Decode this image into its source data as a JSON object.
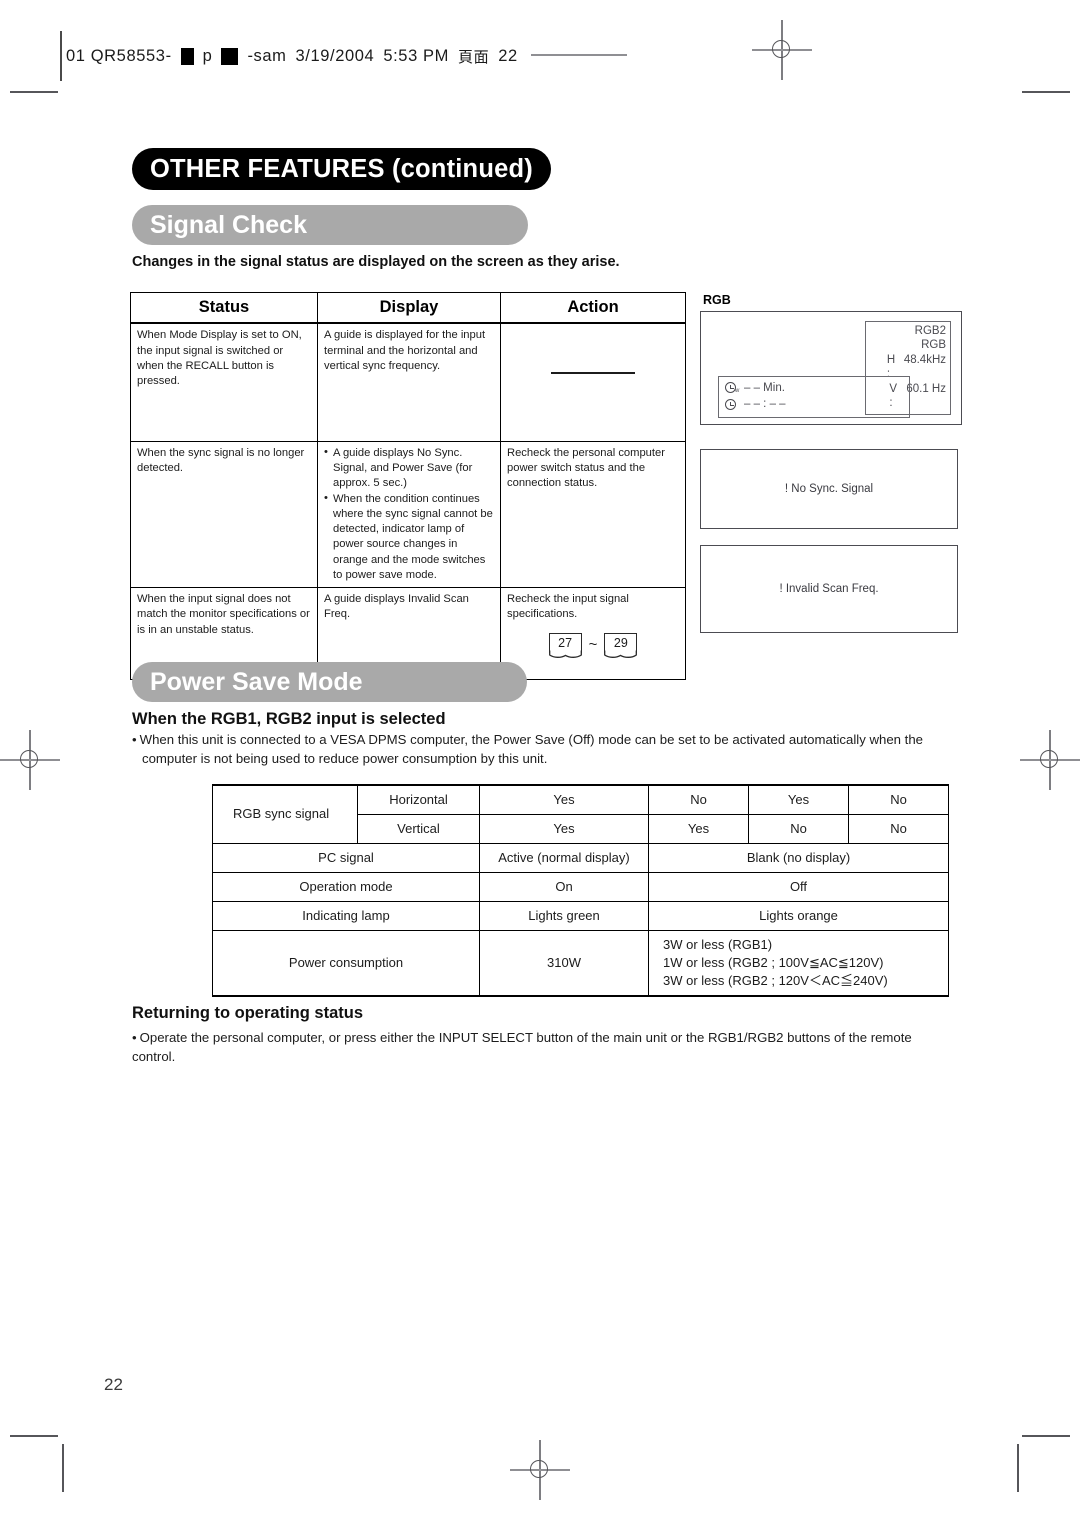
{
  "slug": {
    "prefix": "01 QR58553-",
    "mid": "p",
    "suffix": "-sam",
    "date": "3/19/2004",
    "time": "5:53 PM",
    "cjk_page_label": "頁面",
    "page": "22"
  },
  "header": {
    "chapter_title": "OTHER FEATURES (continued)",
    "section_signal_check": "Signal Check",
    "section_power_save": "Power Save Mode"
  },
  "signal_check": {
    "lead": "Changes in the signal status are displayed on the screen as they arise.",
    "columns": [
      "Status",
      "Display",
      "Action"
    ],
    "rows": [
      {
        "status": "When Mode Display is set to ON, the input signal is switched or when the RECALL button is pressed.",
        "display": "A guide is displayed for the input terminal and the horizontal and vertical sync frequency.",
        "action": ""
      },
      {
        "status": "When the sync signal is no longer detected.",
        "display_bullets": [
          "A guide displays No Sync. Signal, and Power Save (for approx. 5 sec.)",
          "When the condition continues where the sync signal cannot be detected, indicator lamp of power source changes in orange and the mode switches to power save mode."
        ],
        "action": "Recheck the personal computer power switch status and the connection status."
      },
      {
        "status": "When the input signal does not match the monitor specifications or is in an unstable status.",
        "display": "A guide displays Invalid Scan Freq.",
        "action": "Recheck the input signal specifications.",
        "ref_from": "27",
        "ref_separator": "~",
        "ref_to": "29"
      }
    ]
  },
  "osd": {
    "label": "RGB",
    "rgb_panel": {
      "input_name": "RGB2",
      "signal_name": "RGB",
      "h_label": "H :",
      "h_value": "48.4kHz",
      "v_label": "V :",
      "v_value": "60.1 Hz",
      "timer_lamp_value": "– – Min.",
      "timer_clock_value": "– – : – –"
    },
    "no_sync_message": "! No Sync. Signal",
    "invalid_scan_message": "! Invalid Scan Freq."
  },
  "power_save": {
    "subhead": "When the RGB1, RGB2 input is selected",
    "bullet_line1": "When this unit is connected to a VESA DPMS computer, the Power Save (Off) mode can be set to be activated automatically when the",
    "bullet_line2": "computer is not being used to reduce power consumption by this unit.",
    "table": {
      "row_sync_label": "RGB sync signal",
      "row_horizontal_label": "Horizontal",
      "row_horizontal_values": [
        "Yes",
        "No",
        "Yes",
        "No"
      ],
      "row_vertical_label": "Vertical",
      "row_vertical_values": [
        "Yes",
        "Yes",
        "No",
        "No"
      ],
      "row_pc_label": "PC signal",
      "row_pc_active": "Active (normal display)",
      "row_pc_blank": "Blank (no display)",
      "row_mode_label": "Operation mode",
      "row_mode_on": "On",
      "row_mode_off": "Off",
      "row_lamp_label": "Indicating lamp",
      "row_lamp_green": "Lights green",
      "row_lamp_orange": "Lights orange",
      "row_power_label": "Power consumption",
      "row_power_on": "310W",
      "row_power_off_line1": "3W or less (RGB1)",
      "row_power_off_line2": "1W or less (RGB2 ; 100V≦AC≦120V)",
      "row_power_off_line3": "3W or less (RGB2 ; 120V＜AC≦240V)"
    }
  },
  "returning": {
    "subhead": "Returning to operating status",
    "bullet": "Operate the personal computer, or press either the INPUT SELECT button of the main unit or the RGB1/RGB2 buttons of the remote control."
  },
  "footer": {
    "page_number": "22"
  }
}
